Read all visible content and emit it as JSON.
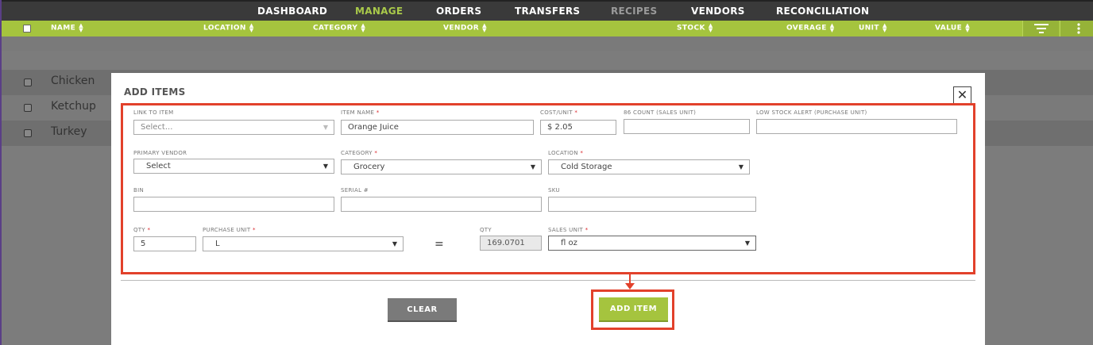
{
  "nav": {
    "items": [
      {
        "label": "DASHBOARD"
      },
      {
        "label": "MANAGE"
      },
      {
        "label": "ORDERS"
      },
      {
        "label": "TRANSFERS"
      },
      {
        "label": "RECIPES"
      },
      {
        "label": "VENDORS"
      },
      {
        "label": "RECONCILIATION"
      }
    ],
    "active": "MANAGE"
  },
  "table": {
    "columns": [
      {
        "label": "NAME"
      },
      {
        "label": "LOCATION"
      },
      {
        "label": "CATEGORY"
      },
      {
        "label": "VENDOR"
      },
      {
        "label": "STOCK"
      },
      {
        "label": "OVERAGE"
      },
      {
        "label": "UNIT"
      },
      {
        "label": "VALUE"
      }
    ],
    "rows": [
      {
        "name": "Chicken"
      },
      {
        "name": "Ketchup"
      },
      {
        "name": "Turkey"
      }
    ],
    "filter_icon": "filter-icon",
    "menu_icon": "kebab-menu-icon"
  },
  "modal": {
    "title": "ADD ITEMS",
    "close_icon": "close-icon",
    "fields": {
      "link_to_item": {
        "label": "LINK TO ITEM",
        "placeholder": "Select..."
      },
      "item_name": {
        "label": "ITEM NAME",
        "value": "Orange Juice"
      },
      "cost_unit": {
        "label": "COST/UNIT",
        "value": "$ 2.05"
      },
      "count_86": {
        "label": "86 COUNT (SALES UNIT)",
        "value": ""
      },
      "low_stock": {
        "label": "LOW STOCK ALERT (PURCHASE UNIT)",
        "value": ""
      },
      "primary_vendor": {
        "label": "PRIMARY VENDOR",
        "value": "Select"
      },
      "category": {
        "label": "CATEGORY",
        "value": "Grocery"
      },
      "location": {
        "label": "LOCATION",
        "value": "Cold Storage"
      },
      "bin": {
        "label": "BIN",
        "value": ""
      },
      "serial": {
        "label": "SERIAL #",
        "value": ""
      },
      "sku": {
        "label": "SKU",
        "value": ""
      },
      "qty": {
        "label": "QTY",
        "value": "5"
      },
      "purchase_unit": {
        "label": "PURCHASE UNIT",
        "value": "L"
      },
      "equals": "=",
      "qty_converted": {
        "label": "QTY",
        "value": "169.0701"
      },
      "sales_unit": {
        "label": "SALES UNIT",
        "value": "fl oz"
      }
    },
    "required_mark": "*",
    "buttons": {
      "clear": "CLEAR",
      "add_item": "ADD ITEM"
    }
  },
  "colors": {
    "accent_green": "#a5c43e",
    "nav_bg": "#3a3a3a",
    "highlight_red": "#e2412b"
  }
}
